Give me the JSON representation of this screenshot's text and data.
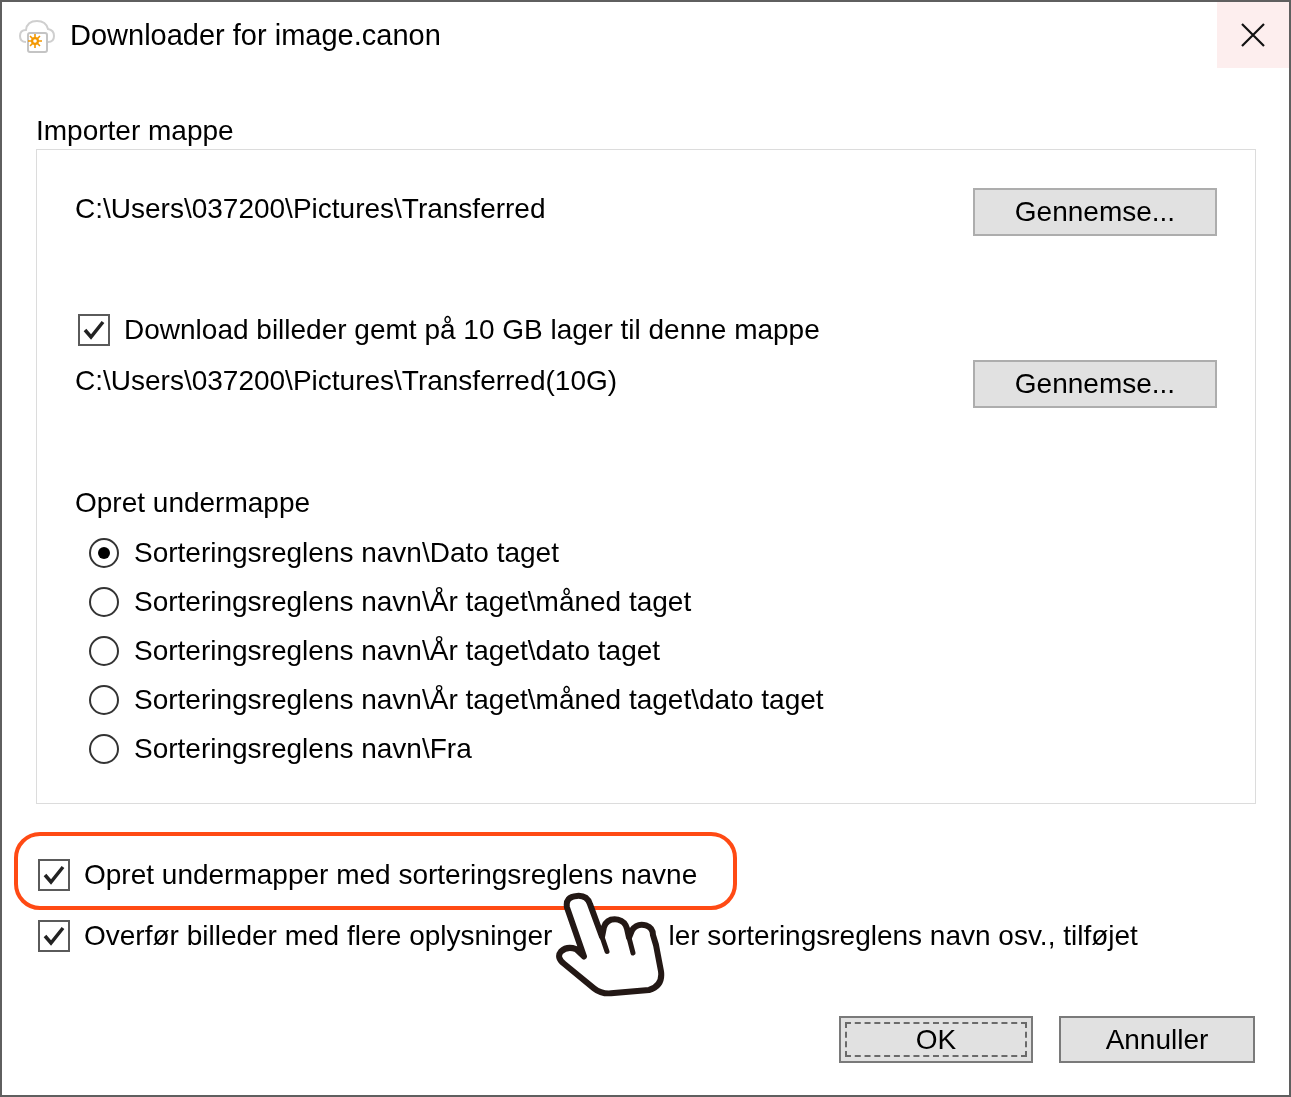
{
  "window": {
    "title": "Downloader for image.canon"
  },
  "import_folder": {
    "label": "Importer mappe",
    "path": "C:\\Users\\037200\\Pictures\\Transferred",
    "browse_button": "Gennemse...",
    "download_10gb": {
      "label": "Download billeder gemt på 10 GB lager til denne mappe",
      "checked": true,
      "path": "C:\\Users\\037200\\Pictures\\Transferred(10G)",
      "browse_button": "Gennemse..."
    },
    "subfolder": {
      "label": "Opret undermappe",
      "options": [
        {
          "label": "Sorteringsreglens navn\\Dato taget",
          "selected": true
        },
        {
          "label": "Sorteringsreglens navn\\År taget\\måned taget",
          "selected": false
        },
        {
          "label": "Sorteringsreglens navn\\År taget\\dato taget",
          "selected": false
        },
        {
          "label": "Sorteringsreglens navn\\År taget\\måned taget\\dato taget",
          "selected": false
        },
        {
          "label": "Sorteringsreglens navn\\Fra",
          "selected": false
        }
      ]
    }
  },
  "options": [
    {
      "label_parts": [
        "Opret undermapper med sorteringsreglens navne"
      ],
      "checked": true,
      "highlighted": true
    },
    {
      "label_parts": [
        "Overfør billeder med flere oplysninger",
        "ler sorteringsreglens navn osv., tilføjet"
      ],
      "checked": true,
      "highlighted": false
    }
  ],
  "buttons": [
    {
      "label": "OK",
      "focused": true
    },
    {
      "label": "Annuller",
      "focused": false
    }
  ]
}
